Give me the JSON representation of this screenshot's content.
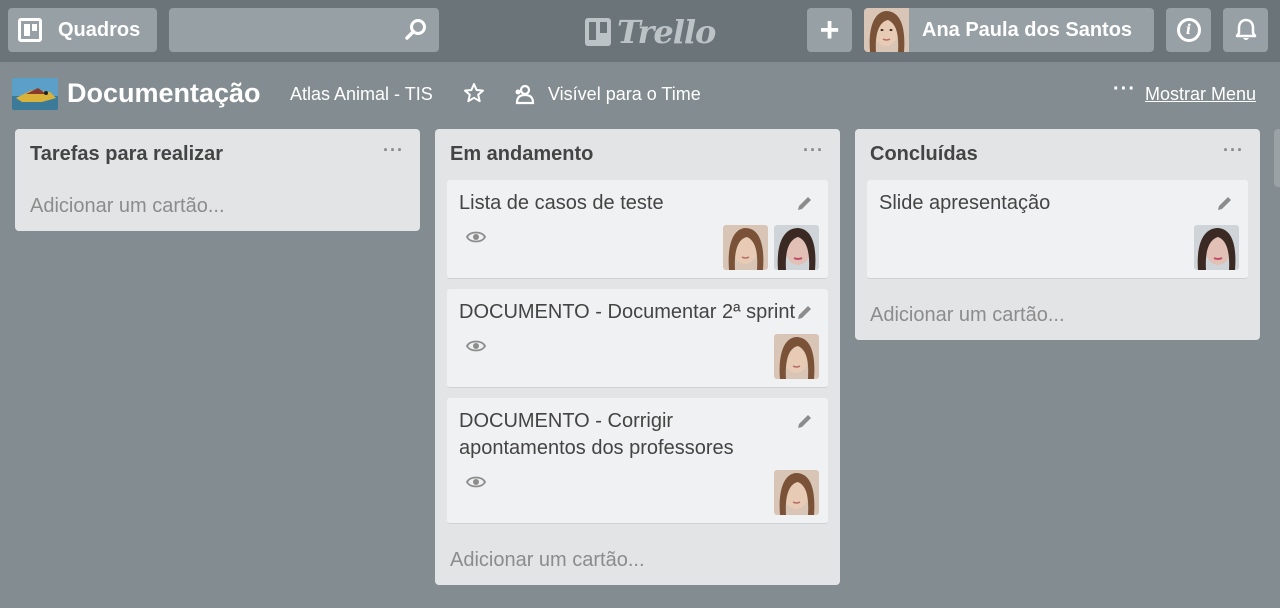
{
  "header": {
    "boards_label": "Quadros",
    "search_value": "",
    "logo_text": "Trello",
    "plus_label": "+",
    "user_name": "Ana Paula dos Santos",
    "info_label": "i"
  },
  "board": {
    "title": "Documentação",
    "team": "Atlas Animal - TIS",
    "visibility": "Visível para o Time",
    "menu_dots": "···",
    "show_menu": "Mostrar Menu"
  },
  "lists": [
    {
      "title": "Tarefas para realizar",
      "dots": "···",
      "add_card": "Adicionar um cartão..."
    },
    {
      "title": "Em andamento",
      "dots": "···",
      "add_card": "Adicionar um cartão...",
      "cards": [
        {
          "title": "Lista de casos de teste"
        },
        {
          "title": "DOCUMENTO - Documentar 2ª sprint"
        },
        {
          "title": "DOCUMENTO - Corrigir apontamentos dos professores"
        }
      ]
    },
    {
      "title": "Concluídas",
      "dots": "···",
      "add_card": "Adicionar um cartão...",
      "cards": [
        {
          "title": "Slide apresentação"
        }
      ]
    }
  ],
  "icons": [
    "boards-icon",
    "search-icon",
    "trello-logo-icon",
    "plus-icon",
    "info-icon",
    "bell-icon",
    "star-icon",
    "team-visibility-icon",
    "pencil-icon",
    "eye-icon"
  ],
  "colors": {
    "background": "#838c91",
    "header": "#6b7479",
    "list": "#e2e4e6",
    "card": "#f0f1f2"
  }
}
